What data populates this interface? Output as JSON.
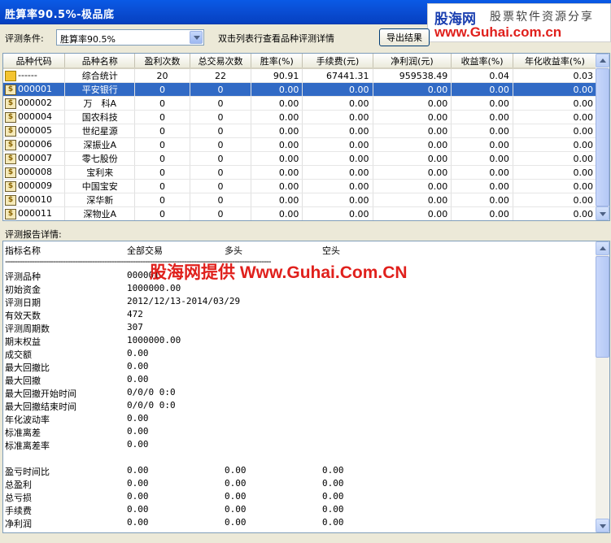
{
  "window": {
    "title": "胜算率90.5%-极品底"
  },
  "brand": {
    "name": "股海网",
    "slogan": "股票软件资源分享",
    "url": "www.Guhai.com.cn"
  },
  "toolbar": {
    "condition_label": "评测条件:",
    "condition_value": "胜算率90.5%",
    "hint": "双击列表行查看品种评测详情",
    "export_label": "导出结果"
  },
  "table": {
    "columns": [
      "品种代码",
      "品种名称",
      "盈利次数",
      "总交易次数",
      "胜率(%)",
      "手续费(元)",
      "净利润(元)",
      "收益率(%)",
      "年化收益率(%)"
    ],
    "summary": {
      "code": "------",
      "name": "综合统计",
      "wins": "20",
      "trades": "22",
      "winrate": "90.91",
      "fee": "67441.31",
      "profit": "959538.49",
      "ret": "0.04",
      "annual": "0.03"
    },
    "rows": [
      {
        "code": "000001",
        "name": "平安银行",
        "wins": "0",
        "trades": "0",
        "winrate": "0.00",
        "fee": "0.00",
        "profit": "0.00",
        "ret": "0.00",
        "annual": "0.00",
        "selected": true
      },
      {
        "code": "000002",
        "name": "万　科A",
        "wins": "0",
        "trades": "0",
        "winrate": "0.00",
        "fee": "0.00",
        "profit": "0.00",
        "ret": "0.00",
        "annual": "0.00"
      },
      {
        "code": "000004",
        "name": "国农科技",
        "wins": "0",
        "trades": "0",
        "winrate": "0.00",
        "fee": "0.00",
        "profit": "0.00",
        "ret": "0.00",
        "annual": "0.00"
      },
      {
        "code": "000005",
        "name": "世纪星源",
        "wins": "0",
        "trades": "0",
        "winrate": "0.00",
        "fee": "0.00",
        "profit": "0.00",
        "ret": "0.00",
        "annual": "0.00"
      },
      {
        "code": "000006",
        "name": "深振业A",
        "wins": "0",
        "trades": "0",
        "winrate": "0.00",
        "fee": "0.00",
        "profit": "0.00",
        "ret": "0.00",
        "annual": "0.00"
      },
      {
        "code": "000007",
        "name": "零七股份",
        "wins": "0",
        "trades": "0",
        "winrate": "0.00",
        "fee": "0.00",
        "profit": "0.00",
        "ret": "0.00",
        "annual": "0.00"
      },
      {
        "code": "000008",
        "name": "宝利来",
        "wins": "0",
        "trades": "0",
        "winrate": "0.00",
        "fee": "0.00",
        "profit": "0.00",
        "ret": "0.00",
        "annual": "0.00"
      },
      {
        "code": "000009",
        "name": "中国宝安",
        "wins": "0",
        "trades": "0",
        "winrate": "0.00",
        "fee": "0.00",
        "profit": "0.00",
        "ret": "0.00",
        "annual": "0.00"
      },
      {
        "code": "000010",
        "name": "深华新",
        "wins": "0",
        "trades": "0",
        "winrate": "0.00",
        "fee": "0.00",
        "profit": "0.00",
        "ret": "0.00",
        "annual": "0.00"
      },
      {
        "code": "000011",
        "name": "深物业A",
        "wins": "0",
        "trades": "0",
        "winrate": "0.00",
        "fee": "0.00",
        "profit": "0.00",
        "ret": "0.00",
        "annual": "0.00"
      }
    ]
  },
  "report": {
    "label": "评测报告详情:",
    "headers": [
      "指标名称",
      "全部交易",
      "多头",
      "空头"
    ],
    "separator": "--------------------------------------------------------------------------------------------------------------",
    "watermark": "股海网提供 Www.Guhai.Com.CN",
    "rows": [
      {
        "name": "评测品种",
        "all": "000001",
        "long": "",
        "short": ""
      },
      {
        "name": "初始资金",
        "all": "1000000.00",
        "long": "",
        "short": ""
      },
      {
        "name": "评测日期",
        "all": "2012/12/13-2014/03/29",
        "long": "",
        "short": ""
      },
      {
        "name": "有效天数",
        "all": "472",
        "long": "",
        "short": ""
      },
      {
        "name": "评测周期数",
        "all": "307",
        "long": "",
        "short": ""
      },
      {
        "name": "期末权益",
        "all": "1000000.00",
        "long": "",
        "short": ""
      },
      {
        "name": "成交额",
        "all": "0.00",
        "long": "",
        "short": ""
      },
      {
        "name": "最大回撤比",
        "all": "0.00",
        "long": "",
        "short": ""
      },
      {
        "name": "最大回撤",
        "all": "0.00",
        "long": "",
        "short": ""
      },
      {
        "name": "最大回撤开始时间",
        "all": "0/0/0 0:0",
        "long": "",
        "short": ""
      },
      {
        "name": "最大回撤结束时间",
        "all": "0/0/0 0:0",
        "long": "",
        "short": ""
      },
      {
        "name": "年化波动率",
        "all": "0.00",
        "long": "",
        "short": ""
      },
      {
        "name": "标准离差",
        "all": "0.00",
        "long": "",
        "short": ""
      },
      {
        "name": "标准离差率",
        "all": "0.00",
        "long": "",
        "short": ""
      },
      {
        "name": "",
        "all": "",
        "long": "",
        "short": ""
      },
      {
        "name": "盈亏时间比",
        "all": "0.00",
        "long": "0.00",
        "short": "0.00"
      },
      {
        "name": "总盈利",
        "all": "0.00",
        "long": "0.00",
        "short": "0.00"
      },
      {
        "name": "总亏损",
        "all": "0.00",
        "long": "0.00",
        "short": "0.00"
      },
      {
        "name": "手续费",
        "all": "0.00",
        "long": "0.00",
        "short": "0.00"
      },
      {
        "name": "净利润",
        "all": "0.00",
        "long": "0.00",
        "short": "0.00"
      }
    ]
  }
}
